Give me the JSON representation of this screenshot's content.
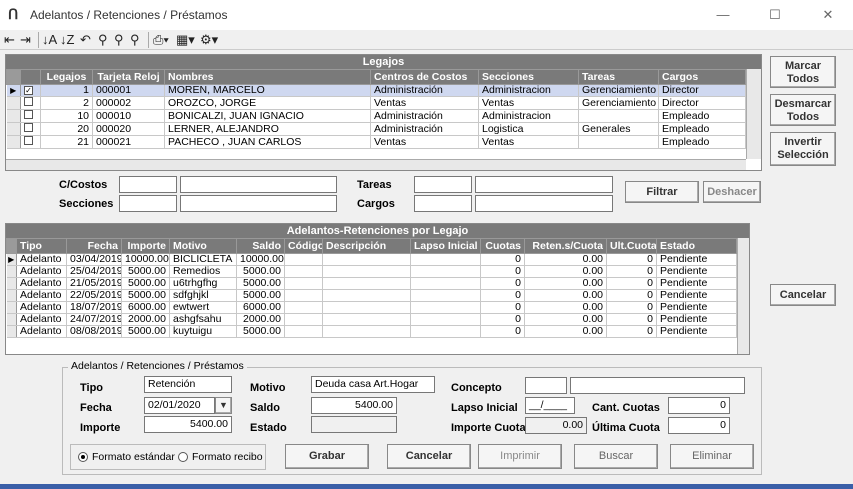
{
  "window": {
    "title": "Adelantos / Retenciones / Préstamos",
    "app_icon": "Ո"
  },
  "legajos": {
    "title": "Legajos",
    "columns": [
      "Legajos",
      "Tarjeta Reloj",
      "Nombres",
      "Centros de Costos",
      "Secciones",
      "Tareas",
      "Cargos"
    ],
    "rows": [
      {
        "checked": "✓",
        "legajo": "1",
        "tarjeta": "000001",
        "nombre": "MOREN, MARCELO",
        "centro": "Administración",
        "seccion": "Administracion",
        "tarea": "Gerenciamiento",
        "cargo": "Director"
      },
      {
        "checked": "",
        "legajo": "2",
        "tarjeta": "000002",
        "nombre": "OROZCO, JORGE",
        "centro": "Ventas",
        "seccion": "Ventas",
        "tarea": "Gerenciamiento",
        "cargo": "Director"
      },
      {
        "checked": "",
        "legajo": "10",
        "tarjeta": "000010",
        "nombre": "BONICALZI, JUAN IGNACIO",
        "centro": "Administración",
        "seccion": "Administracion",
        "tarea": "",
        "cargo": "Empleado"
      },
      {
        "checked": "",
        "legajo": "20",
        "tarjeta": "000020",
        "nombre": "LERNER, ALEJANDRO",
        "centro": "Administración",
        "seccion": "Logistica",
        "tarea": "Generales",
        "cargo": "Empleado"
      },
      {
        "checked": "",
        "legajo": "21",
        "tarjeta": "000021",
        "nombre": "PACHECO , JUAN CARLOS",
        "centro": "Ventas",
        "seccion": "Ventas",
        "tarea": "",
        "cargo": "Empleado"
      }
    ]
  },
  "side_buttons": {
    "marcar": "Marcar Todos",
    "desmarcar": "Desmarcar Todos",
    "invertir": "Invertir Selección",
    "cancelar": "Cancelar"
  },
  "filters": {
    "costos_label": "C/Costos",
    "secciones_label": "Secciones",
    "tareas_label": "Tareas",
    "cargos_label": "Cargos",
    "filtrar": "Filtrar",
    "deshacer": "Deshacer"
  },
  "movs": {
    "title": "Adelantos-Retenciones por Legajo",
    "columns": [
      "Tipo",
      "Fecha",
      "Importe",
      "Motivo",
      "Saldo",
      "Código",
      "Descripción",
      "Lapso Inicial",
      "Cuotas",
      "Reten.s/Cuota",
      "Ult.Cuota",
      "Estado"
    ],
    "rows": [
      {
        "tipo": "Adelanto",
        "fecha": "03/04/2019",
        "importe": "10000.00",
        "motivo": "BICLICLETA",
        "saldo": "10000.00",
        "codigo": "",
        "descripcion": "",
        "lapso": "",
        "cuotas": "0",
        "reten": "0.00",
        "ult": "0",
        "estado": "Pendiente"
      },
      {
        "tipo": "Adelanto",
        "fecha": "25/04/2019",
        "importe": "5000.00",
        "motivo": "Remedios",
        "saldo": "5000.00",
        "codigo": "",
        "descripcion": "",
        "lapso": "",
        "cuotas": "0",
        "reten": "0.00",
        "ult": "0",
        "estado": "Pendiente"
      },
      {
        "tipo": "Adelanto",
        "fecha": "21/05/2019",
        "importe": "5000.00",
        "motivo": "u6trhgfhg",
        "saldo": "5000.00",
        "codigo": "",
        "descripcion": "",
        "lapso": "",
        "cuotas": "0",
        "reten": "0.00",
        "ult": "0",
        "estado": "Pendiente"
      },
      {
        "tipo": "Adelanto",
        "fecha": "22/05/2019",
        "importe": "5000.00",
        "motivo": "sdfghjkl",
        "saldo": "5000.00",
        "codigo": "",
        "descripcion": "",
        "lapso": "",
        "cuotas": "0",
        "reten": "0.00",
        "ult": "0",
        "estado": "Pendiente"
      },
      {
        "tipo": "Adelanto",
        "fecha": "18/07/2019",
        "importe": "6000.00",
        "motivo": "ewtwert",
        "saldo": "6000.00",
        "codigo": "",
        "descripcion": "",
        "lapso": "",
        "cuotas": "0",
        "reten": "0.00",
        "ult": "0",
        "estado": "Pendiente"
      },
      {
        "tipo": "Adelanto",
        "fecha": "24/07/2019",
        "importe": "2000.00",
        "motivo": "ashgfsahu",
        "saldo": "2000.00",
        "codigo": "",
        "descripcion": "",
        "lapso": "",
        "cuotas": "0",
        "reten": "0.00",
        "ult": "0",
        "estado": "Pendiente"
      },
      {
        "tipo": "Adelanto",
        "fecha": "08/08/2019",
        "importe": "5000.00",
        "motivo": "kuytuigu",
        "saldo": "5000.00",
        "codigo": "",
        "descripcion": "",
        "lapso": "",
        "cuotas": "0",
        "reten": "0.00",
        "ult": "0",
        "estado": "Pendiente"
      }
    ]
  },
  "form": {
    "group_title": "Adelantos / Retenciones / Préstamos",
    "tipo_label": "Tipo",
    "tipo_value": "Retención",
    "fecha_label": "Fecha",
    "fecha_value": "02/01/2020",
    "importe_label": "Importe",
    "importe_value": "5400.00",
    "motivo_label": "Motivo",
    "motivo_value": "Deuda casa Art.Hogar",
    "saldo_label": "Saldo",
    "saldo_value": "5400.00",
    "estado_label": "Estado",
    "estado_value": "",
    "concepto_label": "Concepto",
    "concepto_code": "",
    "concepto_desc": "",
    "lapso_label": "Lapso Inicial",
    "lapso_value": "__/____",
    "importe_cuota_label": "Importe Cuota",
    "importe_cuota_value": "0.00",
    "cant_cuotas_label": "Cant. Cuotas",
    "cant_cuotas_value": "0",
    "ultima_cuota_label": "Última Cuota",
    "ultima_cuota_value": "0",
    "radio_estandar": "Formato estándar",
    "radio_recibo": "Formato recibo",
    "grabar": "Grabar",
    "cancelar": "Cancelar",
    "imprimir": "Imprimir",
    "buscar": "Buscar",
    "eliminar": "Eliminar"
  }
}
